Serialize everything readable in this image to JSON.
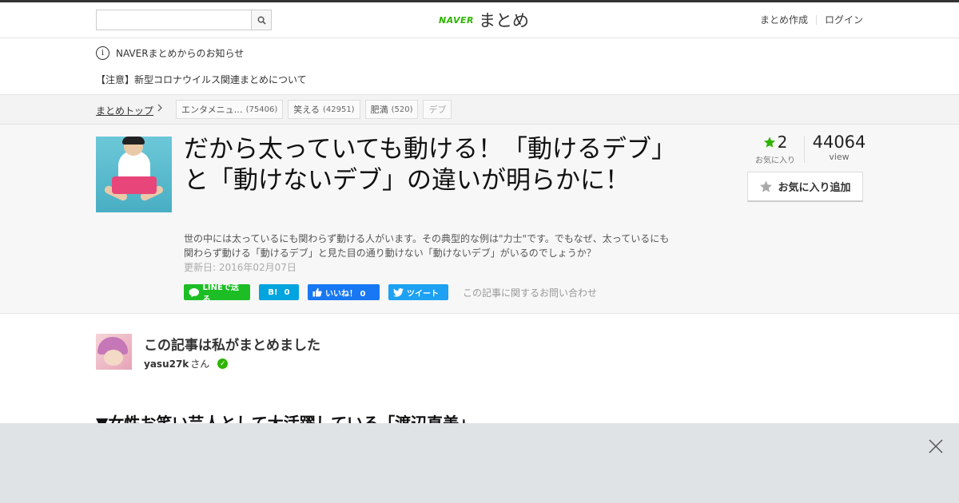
{
  "header": {
    "search_placeholder": "",
    "logo_brand": "NAVER",
    "logo_service": "まとめ",
    "links": [
      "まとめ作成",
      "ログイン"
    ]
  },
  "notices": {
    "title": "NAVERまとめからのお知らせ",
    "item": "【注意】新型コロナウイルス関連まとめについて"
  },
  "breadcrumb": {
    "top": "まとめトップ",
    "tags": [
      {
        "label": "エンタメニュ…",
        "count": "(75406)"
      },
      {
        "label": "笑える",
        "count": "(42951)"
      },
      {
        "label": "肥満",
        "count": "(520)"
      },
      {
        "label": "デブ",
        "count": ""
      }
    ]
  },
  "article": {
    "title": "だから太っていても動ける！「動けるデブ」と「動けないデブ」の違いが明らかに！",
    "description": "世の中には太っているにも関わらず動ける人がいます。その典型的な例は\"力士\"です。でもなぜ、太っているにも関わらず動ける「動けるデブ」と見た目の通り動けない「動けないデブ」がいるのでしょうか？",
    "updated": "更新日: 2016年02月07日",
    "favorites": "2",
    "favorites_label": "お気に入り",
    "views": "44064",
    "views_label": "view",
    "fav_button": "お気に入り追加",
    "share": {
      "line": "LINEで送る",
      "hatena_icon": "B!",
      "hatena_count": "0",
      "facebook": "いいね！ 0",
      "twitter": "ツイート",
      "contact": "この記事に関するお問い合わせ"
    }
  },
  "curator": {
    "title": "この記事は私がまとめました",
    "name": "yasu27k",
    "suffix": "さん"
  },
  "section": {
    "heading": "▼女性お笑い芸人として大活躍している「渡辺直美」"
  },
  "colors": {
    "naver_green": "#2db400",
    "line_green": "#1dbe25",
    "hatena_blue": "#00a4de",
    "facebook_blue": "#1877f2",
    "twitter_blue": "#1da1f2"
  }
}
